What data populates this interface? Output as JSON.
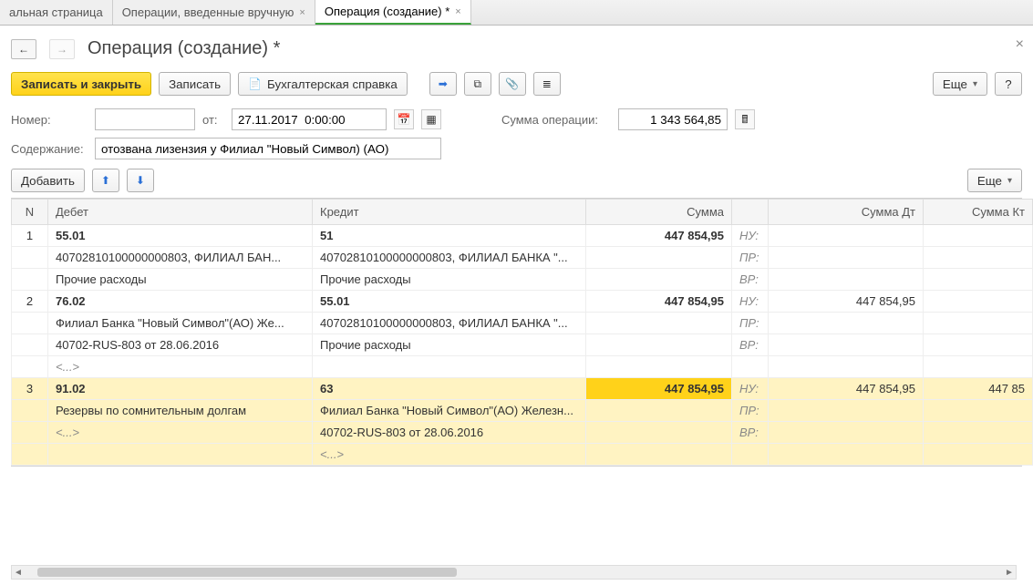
{
  "tabs": [
    {
      "label": "альная страница",
      "closable": false,
      "active": false
    },
    {
      "label": "Операции, введенные вручную",
      "closable": true,
      "active": false
    },
    {
      "label": "Операция (создание) *",
      "closable": true,
      "active": true
    }
  ],
  "title": "Операция (создание) *",
  "toolbar": {
    "save_close": "Записать и закрыть",
    "save": "Записать",
    "accounting_ref": "Бухгалтерская справка",
    "more": "Еще",
    "help": "?"
  },
  "form": {
    "number_label": "Номер:",
    "number_value": "",
    "from_label": "от:",
    "date_value": "27.11.2017  0:00:00",
    "sum_label": "Сумма операции:",
    "sum_value": "1 343 564,85",
    "content_label": "Содержание:",
    "content_value": "отозвана лизензия у Филиал \"Новый Символ) (АО)"
  },
  "table_toolbar": {
    "add": "Добавить",
    "more": "Еще"
  },
  "columns": {
    "n": "N",
    "debit": "Дебет",
    "credit": "Кредит",
    "sum": "Сумма",
    "sum_dt": "Сумма Дт",
    "sum_kt": "Сумма Кт"
  },
  "side_labels": {
    "nu": "НУ:",
    "pr": "ПР:",
    "vr": "ВР:"
  },
  "rows": [
    {
      "n": "1",
      "debit": [
        "55.01",
        "40702810100000000803, ФИЛИАЛ БАН...",
        "Прочие расходы"
      ],
      "credit": [
        "51",
        "40702810100000000803, ФИЛИАЛ БАНКА \"...",
        "Прочие расходы"
      ],
      "sum": "447 854,95",
      "sum_dt": "",
      "sum_kt": ""
    },
    {
      "n": "2",
      "debit": [
        "76.02",
        "Филиал Банка \"Новый Символ\"(АО) Же...",
        "40702-RUS-803 от 28.06.2016",
        "<...>"
      ],
      "credit": [
        "55.01",
        "40702810100000000803, ФИЛИАЛ БАНКА \"...",
        "Прочие расходы",
        ""
      ],
      "sum": "447 854,95",
      "sum_dt": "447 854,95",
      "sum_kt": ""
    },
    {
      "n": "3",
      "selected": true,
      "debit": [
        "91.02",
        "Резервы по сомнительным долгам",
        "<...>",
        ""
      ],
      "credit": [
        "63",
        "Филиал Банка \"Новый Символ\"(АО) Железн...",
        "40702-RUS-803 от 28.06.2016",
        "<...>"
      ],
      "sum": "447 854,95",
      "sum_dt": "447 854,95",
      "sum_kt": "447 85"
    }
  ]
}
